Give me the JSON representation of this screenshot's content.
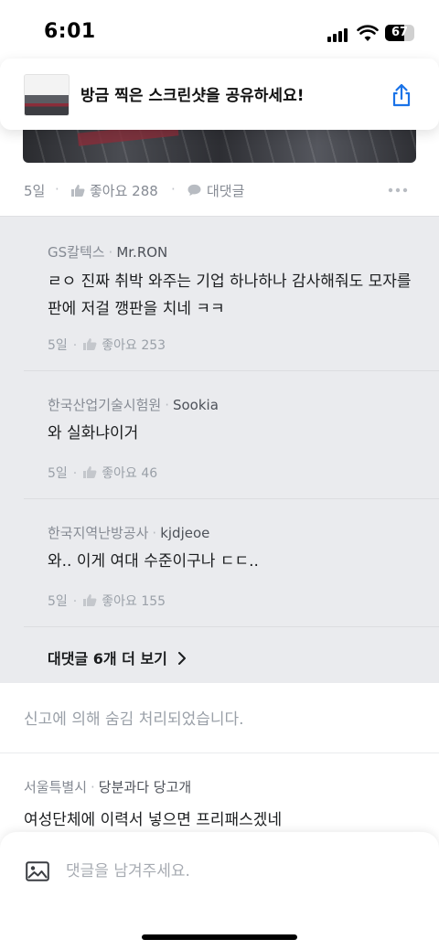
{
  "status_bar": {
    "time": "6:01",
    "battery_level": "67"
  },
  "share_banner": {
    "message": "방금 찍은 스크린샷을 공유하세요!"
  },
  "post_meta": {
    "age": "5일",
    "like_label": "좋아요 288",
    "reply_label": "대댓글"
  },
  "replies": [
    {
      "company": "GS칼텍스",
      "nickname": "Mr.RON",
      "text": "ㄹㅇ 진짜 취박 와주는 기업 하나하나 감사해줘도 모자를판에 저걸 깽판을 치네 ㅋㅋ",
      "age": "5일",
      "like_label": "좋아요 253"
    },
    {
      "company": "한국산업기술시험원",
      "nickname": "Sookia",
      "text": "와 실화냐이거",
      "age": "5일",
      "like_label": "좋아요 46"
    },
    {
      "company": "한국지역난방공사",
      "nickname": "kjdjeoe",
      "text": "와.. 이게 여대 수준이구나 ㄷㄷ..",
      "age": "5일",
      "like_label": "좋아요 155"
    }
  ],
  "more_replies": {
    "label": "대댓글 6개 더 보기"
  },
  "hidden_comment": {
    "text": "신고에 의해 숨김 처리되었습니다."
  },
  "next_comment": {
    "location": "서울특별시",
    "nickname": "당분과다 당고개",
    "text": "여성단체에 이력서 넣으면 프리패스겠네"
  },
  "comment_input": {
    "placeholder": "댓글을 남겨주세요."
  },
  "icons": {
    "share": "share-icon",
    "like": "thumb-up-icon",
    "reply": "speech-bubble-icon",
    "more": "more-dots-icon",
    "chevron": "chevron-right-icon",
    "image": "image-icon"
  }
}
